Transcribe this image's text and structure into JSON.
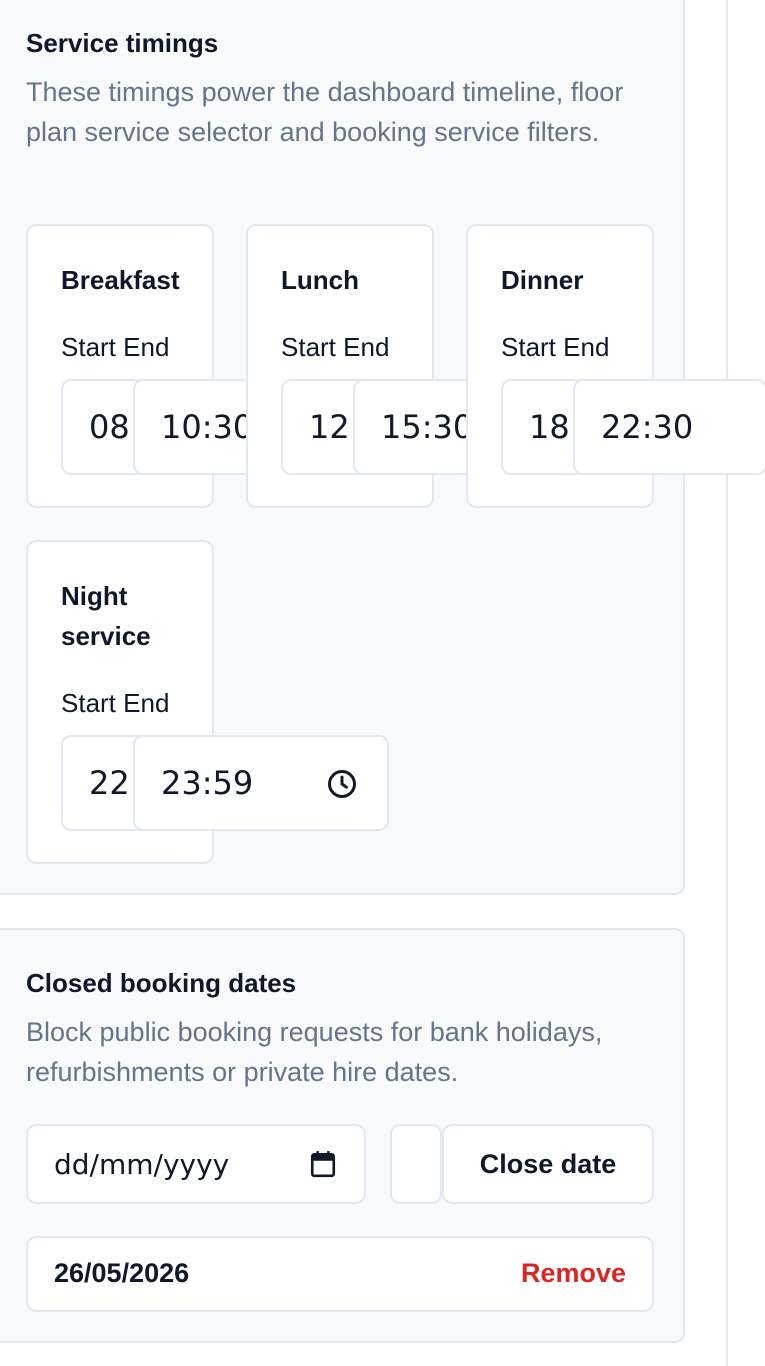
{
  "service_timings": {
    "title": "Service timings",
    "description": "These timings power the dashboard timeline, floor plan service selector and booking service filters.",
    "start_label": "Start",
    "end_label": "End",
    "services": [
      {
        "name": "Breakfast",
        "start": "08",
        "end": "10:30"
      },
      {
        "name": "Lunch",
        "start": "12:",
        "end": "15:30"
      },
      {
        "name": "Dinner",
        "start": "18:",
        "end": "22:30"
      },
      {
        "name": "Night service",
        "start": "22:",
        "end": "23:59"
      }
    ]
  },
  "closed_dates": {
    "title": "Closed booking dates",
    "description": "Block public booking requests for bank holidays, refurbishments or private hire dates.",
    "date_placeholder": "dd/mm/yyyy",
    "close_button": "Close date",
    "entries": [
      {
        "date": "26/05/2026",
        "remove_label": "Remove"
      }
    ]
  },
  "colors": {
    "panel_bg": "#f8fafc",
    "border": "#e2e8f0",
    "muted_text": "#64748b",
    "danger": "#dc2626"
  }
}
